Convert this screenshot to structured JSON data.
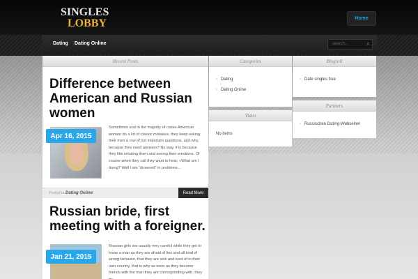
{
  "header": {
    "logo_line1": "SINGLES",
    "logo_line2": "LOBBY",
    "home_label": "Home"
  },
  "nav": {
    "items": [
      {
        "label": "Dating"
      },
      {
        "label": "Dating Online"
      }
    ],
    "search_placeholder": "search..."
  },
  "main": {
    "heading": "Recent Posts",
    "posts": [
      {
        "title": "Difference between American and Russian women",
        "date": "Apr 16, 2015",
        "excerpt": "Sometimes and in the majority of cases American women do a lot of classic mistakes, they keep asking their men a row of not important questions, and why, because they need answers? No way, it is because they like irritating them and seeing their emotions. Of course when they call they want to hear, «What am I doing? Well I am \"drowned\" in problems…",
        "meta_prefix": "Posted in",
        "category": "Dating Online",
        "read_more": "Read More"
      },
      {
        "title": "Russian bride, first meeting with a foreigner.",
        "date": "Jan 21, 2015",
        "excerpt": "Russian girls are usually very careful while they get to know a man as they are afraid of lies and all kind of wrong behavior, that they are sick and tired of in their own country, that is why as soon as they become friends with the man they are corresponding with, they try"
      }
    ]
  },
  "sidebar_left": {
    "categories": {
      "heading": "Categories",
      "items": [
        "Dating",
        "Dating Online"
      ]
    },
    "video": {
      "heading": "Video",
      "empty_text": "No items"
    }
  },
  "sidebar_right": {
    "blogroll": {
      "heading": "Blogroll",
      "items": [
        "Date singles free"
      ]
    },
    "partners": {
      "heading": "Partners",
      "items": [
        "Russischen Dating-Webseiten"
      ]
    }
  },
  "colors": {
    "accent": "#29a7e8",
    "logo_gold": "#e8b13a",
    "header_bg": "#0a0a0a"
  }
}
